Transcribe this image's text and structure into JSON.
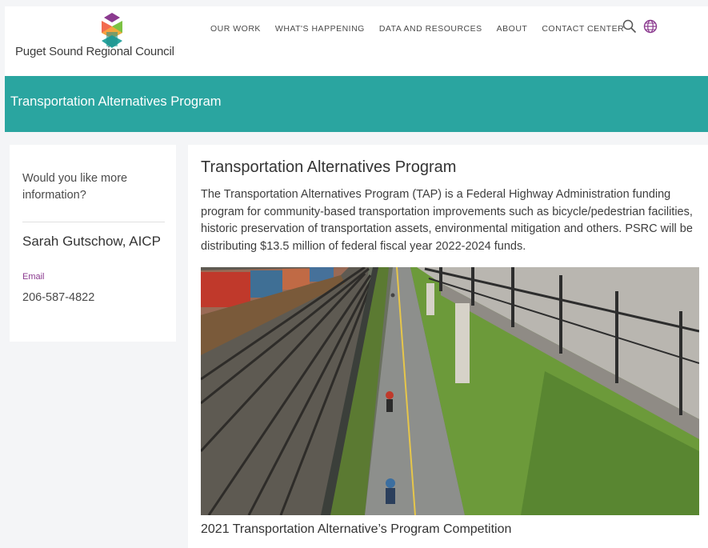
{
  "header": {
    "logo_text": "Puget Sound Regional Council",
    "nav": [
      "OUR WORK",
      "WHAT'S HAPPENING",
      "DATA AND RESOURCES",
      "ABOUT",
      "CONTACT CENTER"
    ],
    "icons": [
      "search-icon",
      "globe-icon"
    ]
  },
  "banner": {
    "title": "Transportation Alternatives Program"
  },
  "sidebar": {
    "question": "Would you like more information?",
    "contact_name": "Sarah Gutschow, AICP",
    "email_label": "Email",
    "phone": "206-587-4822"
  },
  "content": {
    "title": "Transportation Alternatives Program",
    "paragraph": "The Transportation Alternatives Program (TAP) is a Federal Highway Administration funding program for community-based transportation improvements such as bicycle/pedestrian facilities, historic preservation of transportation assets, environmental mitigation and others.  PSRC will be distributing $13.5 million of federal fiscal year 2022-2024 funds.",
    "caption": "2021 Transportation Alternative’s Program Competition"
  },
  "colors": {
    "banner": "#2aa5a0",
    "email_link": "#8b3a8f",
    "globe_icon": "#8b3a8f"
  }
}
